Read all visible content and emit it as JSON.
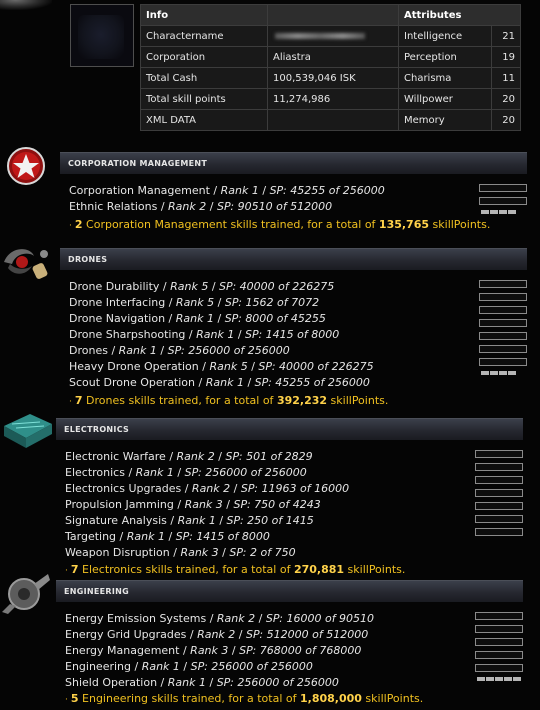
{
  "info": {
    "headers": {
      "info": "Info",
      "attributes": "Attributes"
    },
    "rows": [
      {
        "label": "Charactername",
        "value": "",
        "attr": "Intelligence",
        "attr_val": "21"
      },
      {
        "label": "Corporation",
        "value": "Aliastra",
        "attr": "Perception",
        "attr_val": "19"
      },
      {
        "label": "Total Cash",
        "value": "100,539,046 ISK",
        "attr": "Charisma",
        "attr_val": "11"
      },
      {
        "label": "Total skill points",
        "value": "11,274,986",
        "attr": "Willpower",
        "attr_val": "20"
      },
      {
        "label": "XML DATA",
        "value": "",
        "attr": "Memory",
        "attr_val": "20"
      }
    ]
  },
  "groups": [
    {
      "title": "CORPORATION MANAGEMENT",
      "icon": "corporation-star-icon",
      "skills": [
        {
          "name": "Corporation Management",
          "rank": "Rank 1",
          "sp": "SP: 45255 of 256000",
          "level": 4
        },
        {
          "name": "Ethnic Relations",
          "rank": "Rank 2",
          "sp": "SP: 90510 of 512000",
          "level": 4
        }
      ],
      "summary": {
        "count": "2",
        "text": "Corporation Management skills trained, for a total of",
        "total": "135,765",
        "unit": "skillPoints."
      }
    },
    {
      "title": "DRONES",
      "icon": "drone-icon",
      "skills": [
        {
          "name": "Drone Durability",
          "rank": "Rank 5",
          "sp": "SP: 40000 of 226275",
          "level": 3
        },
        {
          "name": "Drone Interfacing",
          "rank": "Rank 5",
          "sp": "SP: 1562 of 7072",
          "level": 1
        },
        {
          "name": "Drone Navigation",
          "rank": "Rank 1",
          "sp": "SP: 8000 of 45255",
          "level": 3
        },
        {
          "name": "Drone Sharpshooting",
          "rank": "Rank 1",
          "sp": "SP: 1415 of 8000",
          "level": 2
        },
        {
          "name": "Drones",
          "rank": "Rank 1",
          "sp": "SP: 256000 of 256000",
          "level": 5
        },
        {
          "name": "Heavy Drone Operation",
          "rank": "Rank 5",
          "sp": "SP: 40000 of 226275",
          "level": 3
        },
        {
          "name": "Scout Drone Operation",
          "rank": "Rank 1",
          "sp": "SP: 45255 of 256000",
          "level": 4
        }
      ],
      "summary": {
        "count": "7",
        "text": "Drones skills trained, for a total of",
        "total": "392,232",
        "unit": "skillPoints."
      }
    },
    {
      "title": "ELECTRONICS",
      "icon": "electronics-icon",
      "skills": [
        {
          "name": "Electronic Warfare",
          "rank": "Rank 2",
          "sp": "SP: 501 of 2829",
          "level": 1
        },
        {
          "name": "Electronics",
          "rank": "Rank 1",
          "sp": "SP: 256000 of 256000",
          "level": 5
        },
        {
          "name": "Electronics Upgrades",
          "rank": "Rank 2",
          "sp": "SP: 11963 of 16000",
          "level": 2
        },
        {
          "name": "Propulsion Jamming",
          "rank": "Rank 3",
          "sp": "SP: 750 of 4243",
          "level": 1
        },
        {
          "name": "Signature Analysis",
          "rank": "Rank 1",
          "sp": "SP: 250 of 1415",
          "level": 1
        },
        {
          "name": "Targeting",
          "rank": "Rank 1",
          "sp": "SP: 1415 of 8000",
          "level": 2
        },
        {
          "name": "Weapon Disruption",
          "rank": "Rank 3",
          "sp": "SP: 2 of 750",
          "level": 0
        }
      ],
      "summary": {
        "count": "7",
        "text": "Electronics skills trained, for a total of",
        "total": "270,881",
        "unit": "skillPoints."
      }
    },
    {
      "title": "ENGINEERING",
      "icon": "engineering-icon",
      "skills": [
        {
          "name": "Energy Emission Systems",
          "rank": "Rank 2",
          "sp": "SP: 16000 of 90510",
          "level": 3
        },
        {
          "name": "Energy Grid Upgrades",
          "rank": "Rank 2",
          "sp": "SP: 512000 of 512000",
          "level": 5
        },
        {
          "name": "Energy Management",
          "rank": "Rank 3",
          "sp": "SP: 768000 of 768000",
          "level": 5
        },
        {
          "name": "Engineering",
          "rank": "Rank 1",
          "sp": "SP: 256000 of 256000",
          "level": 5
        },
        {
          "name": "Shield Operation",
          "rank": "Rank 1",
          "sp": "SP: 256000 of 256000",
          "level": 5
        }
      ],
      "summary": {
        "count": "5",
        "text": "Engineering skills trained, for a total of",
        "total": "1,808,000",
        "unit": "skillPoints."
      }
    }
  ]
}
